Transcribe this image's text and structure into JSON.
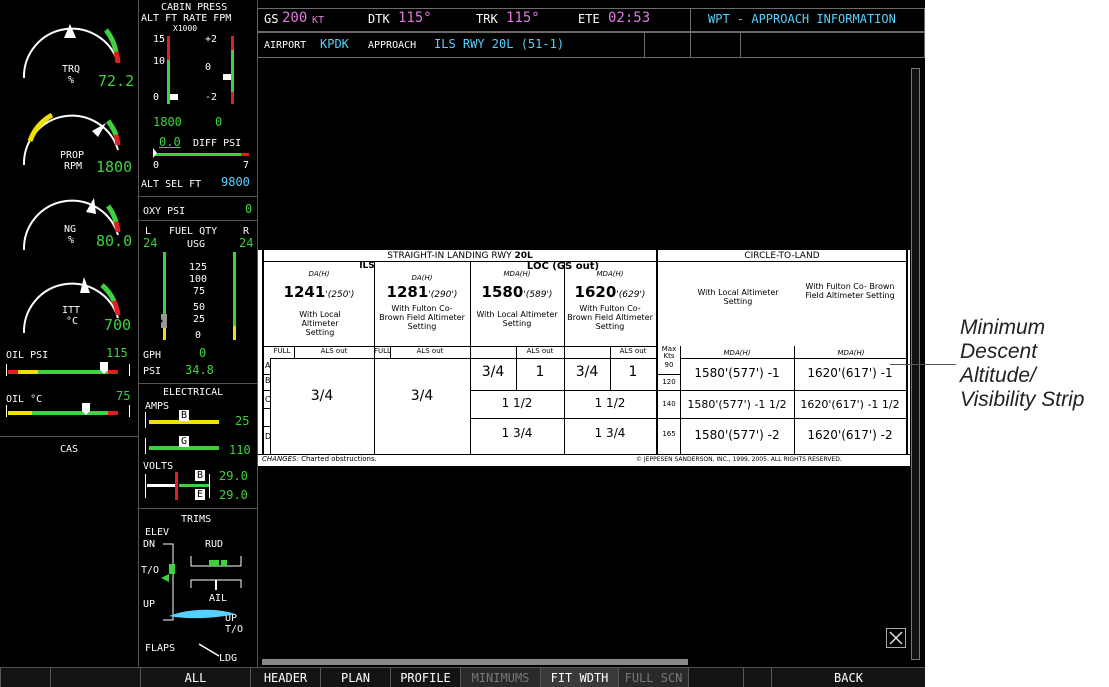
{
  "engine": {
    "trq": {
      "label": "TRQ",
      "unit": "%",
      "value": "72.2"
    },
    "prop": {
      "label": "PROP",
      "unit": "RPM",
      "value": "1800"
    },
    "ng": {
      "label": "NG",
      "unit": "%",
      "value": "80.0"
    },
    "itt": {
      "label": "ITT",
      "unit": "°C",
      "value": "700"
    },
    "oil_psi": {
      "label": "OIL PSI",
      "value": "115"
    },
    "oil_c": {
      "label": "OIL °C",
      "value": "75"
    },
    "cas": "CAS"
  },
  "pressurization": {
    "title": "CABIN PRESS",
    "header": "ALT FT RATE FPM",
    "scale": "X1000",
    "alt_ticks": [
      "15",
      "10",
      "0"
    ],
    "rate_ticks": [
      "+2",
      "0",
      "-2"
    ],
    "cabin_alt": "1800",
    "cabin_rate": "0",
    "diff_value": "0.0",
    "diff_label": "DIFF PSI",
    "diff_min": "0",
    "diff_max": "7",
    "alt_sel_label": "ALT SEL FT",
    "alt_sel_value": "9800",
    "oxy_label": "OXY PSI",
    "oxy_value": "0"
  },
  "fuel": {
    "l": "L",
    "title": "FUEL QTY",
    "r": "R",
    "left_value": "24",
    "unit": "USG",
    "right_value": "24",
    "ticks": [
      "125",
      "100",
      "75",
      "50",
      "25",
      "0"
    ],
    "gph_label": "GPH",
    "gph_value": "0",
    "psi_label": "PSI",
    "psi_value": "34.8"
  },
  "electrical": {
    "title": "ELECTRICAL",
    "amps_label": "AMPS",
    "amps_b": "B",
    "amps_b_value": "25",
    "amps_g": "G",
    "amps_g_value": "110",
    "volts_label": "VOLTS",
    "volts_b": "B",
    "volts_b_value": "29.0",
    "volts_e": "E",
    "volts_e_value": "29.0"
  },
  "trims": {
    "title": "TRIMS",
    "elev": "ELEV",
    "dn": "DN",
    "to": "T/O",
    "up": "UP",
    "rud": "RUD",
    "ail": "AIL",
    "up2": "UP",
    "to2": "T/O",
    "flaps": "FLAPS",
    "ldg": "LDG"
  },
  "nav": {
    "gs_label": "GS",
    "gs_value": "200",
    "gs_unit": "KT",
    "dtk_label": "DTK",
    "dtk_value": "115°",
    "trk_label": "TRK",
    "trk_value": "115°",
    "ete_label": "ETE",
    "ete_value": "02:53",
    "page_title": "WPT - APPROACH INFORMATION",
    "airport_label": "AIRPORT",
    "airport_value": "KPDK",
    "approach_label": "APPROACH",
    "approach_value": "ILS RWY 20L (51-1)"
  },
  "minimums": {
    "straight_title": "STRAIGHT-IN LANDING RWY",
    "runway": "20L",
    "circle_title": "CIRCLE-TO-LAND",
    "ils": "ILS",
    "loc": "LOC (GS out)",
    "da_h": "DA(H)",
    "mda_h": "MDA(H)",
    "col1_alt": "1241",
    "col1_h": "'(250')",
    "col1_note": "With Local Altimeter Setting",
    "col2_alt": "1281",
    "col2_h": "'(290')",
    "col2_note": "With Fulton Co- Brown Field Altimeter Setting",
    "col3_alt": "1580",
    "col3_h": "'(589')",
    "col3_note": "With Local Altimeter Setting",
    "col4_alt": "1620",
    "col4_h": "'(629')",
    "col4_note": "With Fulton Co- Brown Field Altimeter Setting",
    "circ1_note": "With Local Altimeter Setting",
    "circ2_note": "With Fulton Co- Brown Field Altimeter Setting",
    "full": "FULL",
    "als_out": "ALS out",
    "max_kts": "Max Kts",
    "cats": [
      "A",
      "B",
      "C",
      "D"
    ],
    "speeds": [
      "90",
      "120",
      "140",
      "165"
    ],
    "ils_vis": "3/4",
    "loc_ab_full": "3/4",
    "loc_ab_als": "1",
    "loc_ab_full2": "3/4",
    "loc_ab_als2": "1",
    "loc_c": "1 1/2",
    "loc_c2": "1 1/2",
    "loc_d": "1 3/4",
    "loc_d2": "1 3/4",
    "circ_rows": [
      {
        "local": "1580'(577') -1",
        "fulton": "1620'(617') -1"
      },
      {
        "local": "1580'(577') -1 1/2",
        "fulton": "1620'(617') -1 1/2"
      },
      {
        "local": "1580'(577') -2",
        "fulton": "1620'(617') -2"
      }
    ],
    "changes_label": "CHANGES:",
    "changes_text": "Charted obstructions.",
    "copyright": "© JEPPESEN SANDERSON, INC., 1999, 2005. ALL RIGHTS RESERVED."
  },
  "callout": {
    "line1": "Minimum",
    "line2": "Descent",
    "line3": "Altitude/",
    "line4": "Visibility Strip"
  },
  "softkeys": [
    "",
    "",
    "ALL",
    "HEADER",
    "PLAN",
    "PROFILE",
    "MINIMUMS",
    "FIT WDTH",
    "FULL SCN",
    "",
    "",
    "BACK"
  ],
  "colors": {
    "green": "#3fd23f",
    "magenta": "#e07ae0",
    "cyan": "#54d2ff",
    "yellow": "#f0e000",
    "red": "#e02020"
  }
}
